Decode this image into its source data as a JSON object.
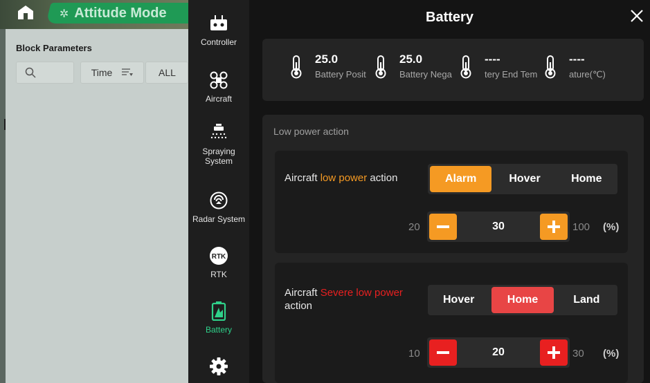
{
  "top_bar": {
    "mode_label": "Attitude Mode",
    "mode_icon": "drone-icon"
  },
  "block_panel": {
    "title": "Block Parameters",
    "sort_label": "Time",
    "filter_label": "ALL"
  },
  "sidebar": {
    "items": [
      {
        "label": "Controller",
        "icon": "controller-icon",
        "active": false
      },
      {
        "label": "Aircraft",
        "icon": "aircraft-icon",
        "active": false
      },
      {
        "label": "Spraying System",
        "icon": "spraying-icon",
        "active": false
      },
      {
        "label": "Radar System",
        "icon": "radar-icon",
        "active": false
      },
      {
        "label": "RTK",
        "icon": "rtk-icon",
        "active": false
      },
      {
        "label": "Battery",
        "icon": "battery-icon",
        "active": true
      },
      {
        "label": "",
        "icon": "gear-icon",
        "active": false
      }
    ],
    "active_color": "#2fd18a"
  },
  "main": {
    "title": "Battery",
    "temperatures": [
      {
        "value": "25.0",
        "label": "Battery Posit"
      },
      {
        "value": "25.0",
        "label": "Battery Nega"
      },
      {
        "value": "----",
        "label": "tery End Tem"
      },
      {
        "value": "----",
        "label": "ature(℃)"
      }
    ],
    "low_power": {
      "heading": "Low power action",
      "low": {
        "label_prefix": "Aircraft ",
        "label_highlight": "low power",
        "label_suffix": " action",
        "highlight_color": "#f59a23",
        "options": [
          "Alarm",
          "Hover",
          "Home"
        ],
        "selected": "Alarm",
        "min": "20",
        "value": "30",
        "max": "100",
        "unit": "(%)"
      },
      "severe": {
        "label_prefix": "Aircraft ",
        "label_highlight": "Severe low power",
        "label_suffix": " action",
        "highlight_color": "#e82020",
        "options": [
          "Hover",
          "Home",
          "Land"
        ],
        "selected": "Home",
        "min": "10",
        "value": "20",
        "max": "30",
        "unit": "(%)"
      }
    }
  },
  "colors": {
    "orange": "#f59a23",
    "red": "#e82020",
    "green": "#1f9a55"
  }
}
